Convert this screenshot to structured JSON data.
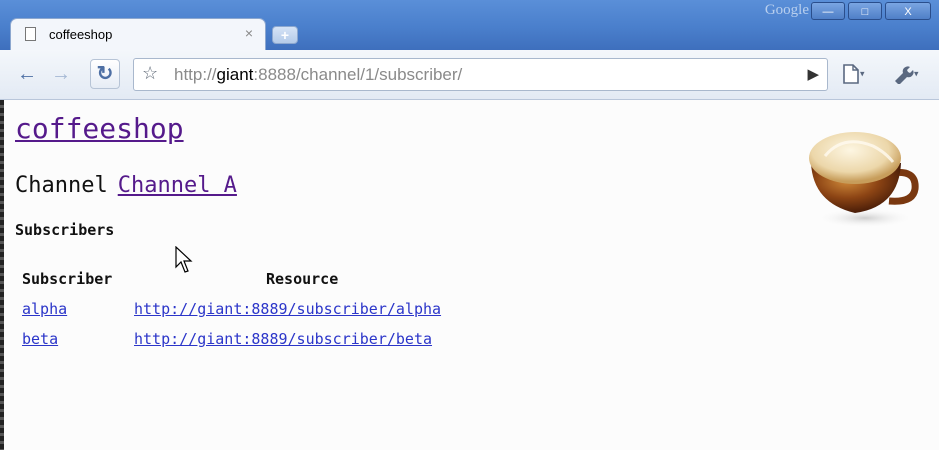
{
  "window": {
    "brand": "Google",
    "minimize": "—",
    "maximize": "□",
    "close": "X"
  },
  "tab": {
    "title": "coffeeshop",
    "close": "×",
    "new_tab": "+"
  },
  "toolbar": {
    "back": "←",
    "forward": "→",
    "reload": "↻",
    "star": "☆",
    "go": "▶",
    "page_menu": "🗋",
    "wrench_menu": "🔧",
    "caret": "▾"
  },
  "address": {
    "prefix": "http://",
    "host": "giant",
    "rest": ":8888/channel/1/subscriber/"
  },
  "page": {
    "title": "coffeeshop",
    "channel_label": "Channel",
    "channel_link": "Channel A",
    "subscribers_heading": "Subscribers",
    "table": {
      "headers": [
        "Subscriber",
        "Resource"
      ],
      "rows": [
        {
          "subscriber": "alpha",
          "resource": "http://giant:8889/subscriber/alpha"
        },
        {
          "subscriber": "beta",
          "resource": "http://giant:8889/subscriber/beta"
        }
      ]
    }
  },
  "colors": {
    "titlebar": "#4a7fcc",
    "link_visited": "#551a8b",
    "link": "#2b35c9"
  },
  "icons": [
    "page-icon",
    "back-icon",
    "forward-icon",
    "reload-icon",
    "star-icon",
    "go-icon",
    "page-menu-icon",
    "wrench-icon",
    "coffee-cup-image",
    "mouse-cursor"
  ]
}
